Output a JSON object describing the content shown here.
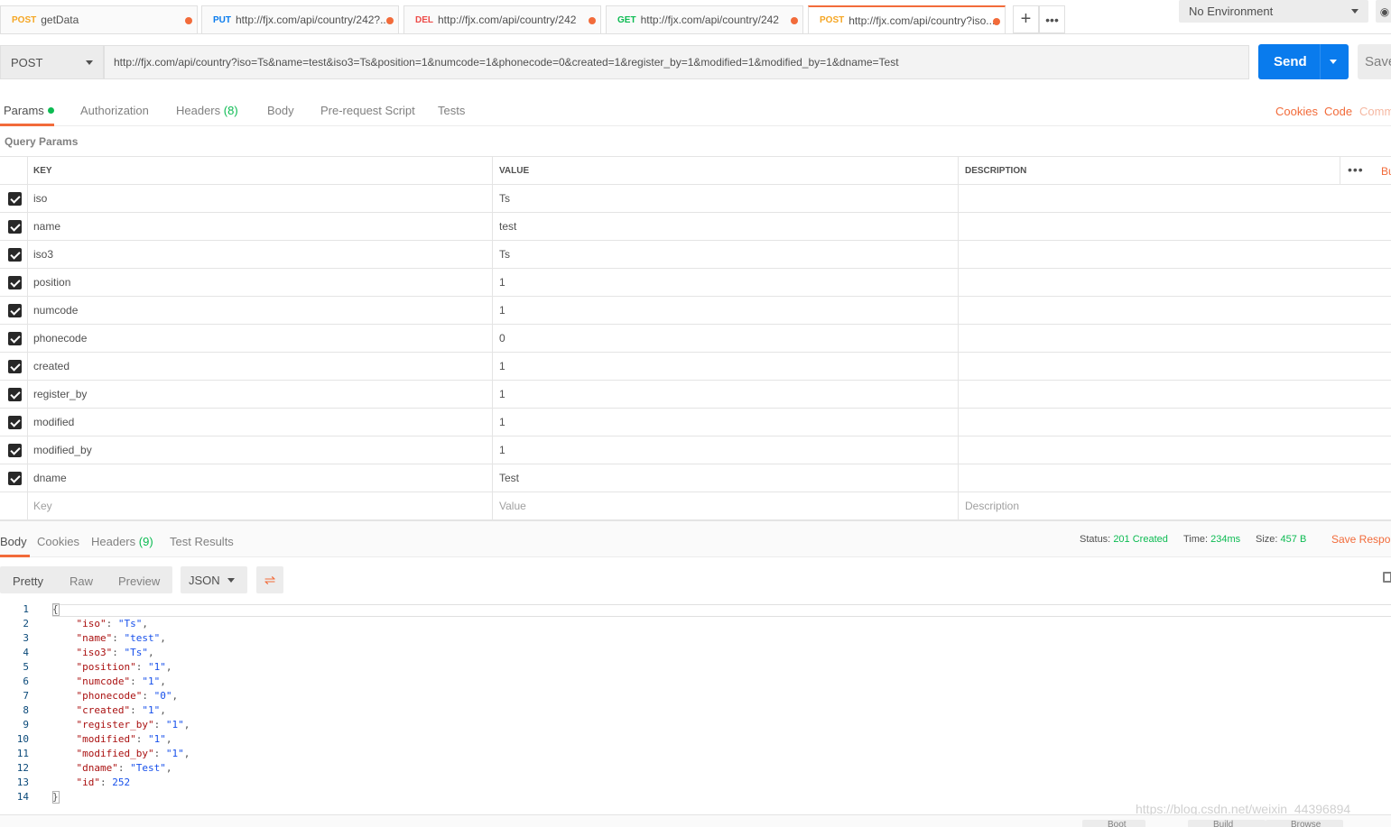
{
  "tabs": [
    {
      "method": "POST",
      "label": "getData"
    },
    {
      "method": "PUT",
      "label": "http://fjx.com/api/country/242?..."
    },
    {
      "method": "DEL",
      "label": "http://fjx.com/api/country/242"
    },
    {
      "method": "GET",
      "label": "http://fjx.com/api/country/242"
    },
    {
      "method": "POST",
      "label": "http://fjx.com/api/country?iso..."
    }
  ],
  "environment": "No Environment",
  "request": {
    "method": "POST",
    "url": "http://fjx.com/api/country?iso=Ts&name=test&iso3=Ts&position=1&numcode=1&phonecode=0&created=1&register_by=1&modified=1&modified_by=1&dname=Test",
    "send_label": "Send",
    "save_label": "Save"
  },
  "request_tabs": {
    "params": "Params",
    "authorization": "Authorization",
    "headers": "Headers",
    "headers_count": "(8)",
    "body": "Body",
    "prerequest": "Pre-request Script",
    "tests": "Tests",
    "cookies": "Cookies",
    "code": "Code",
    "comments": "Comm"
  },
  "query_params": {
    "title": "Query Params",
    "col_key": "KEY",
    "col_value": "VALUE",
    "col_description": "DESCRIPTION",
    "bulk_edit": "Bu",
    "rows": [
      {
        "key": "iso",
        "value": "Ts"
      },
      {
        "key": "name",
        "value": "test"
      },
      {
        "key": "iso3",
        "value": "Ts"
      },
      {
        "key": "position",
        "value": "1"
      },
      {
        "key": "numcode",
        "value": "1"
      },
      {
        "key": "phonecode",
        "value": "0"
      },
      {
        "key": "created",
        "value": "1"
      },
      {
        "key": "register_by",
        "value": "1"
      },
      {
        "key": "modified",
        "value": "1"
      },
      {
        "key": "modified_by",
        "value": "1"
      },
      {
        "key": "dname",
        "value": "Test"
      }
    ],
    "placeholder": {
      "key": "Key",
      "value": "Value",
      "description": "Description"
    }
  },
  "response": {
    "tabs": {
      "body": "Body",
      "cookies": "Cookies",
      "headers": "Headers",
      "headers_count": "(9)",
      "test_results": "Test Results"
    },
    "status_label": "Status:",
    "status_value": "201 Created",
    "time_label": "Time:",
    "time_value": "234ms",
    "size_label": "Size:",
    "size_value": "457 B",
    "save_response": "Save Respo",
    "formats": {
      "pretty": "Pretty",
      "raw": "Raw",
      "preview": "Preview"
    },
    "language": "JSON",
    "body_json": [
      [
        "iso",
        "\"Ts\""
      ],
      [
        "name",
        "\"test\""
      ],
      [
        "iso3",
        "\"Ts\""
      ],
      [
        "position",
        "\"1\""
      ],
      [
        "numcode",
        "\"1\""
      ],
      [
        "phonecode",
        "\"0\""
      ],
      [
        "created",
        "\"1\""
      ],
      [
        "register_by",
        "\"1\""
      ],
      [
        "modified",
        "\"1\""
      ],
      [
        "modified_by",
        "\"1\""
      ],
      [
        "dname",
        "\"Test\""
      ],
      [
        "id",
        "252"
      ]
    ]
  },
  "statusbar": {
    "bootcamp": "Boot",
    "build": "Build",
    "browse": "Browse"
  },
  "watermark": "https://blog.csdn.net/weixin_44396894",
  "colors": {
    "accent": "#f26b3a",
    "send": "#097bed",
    "success": "#0cbb52"
  },
  "icons": [
    "plus-icon",
    "more-icon",
    "eye-icon",
    "caret-down-icon",
    "checkbox-icon",
    "wrap-icon",
    "copy-icon"
  ]
}
